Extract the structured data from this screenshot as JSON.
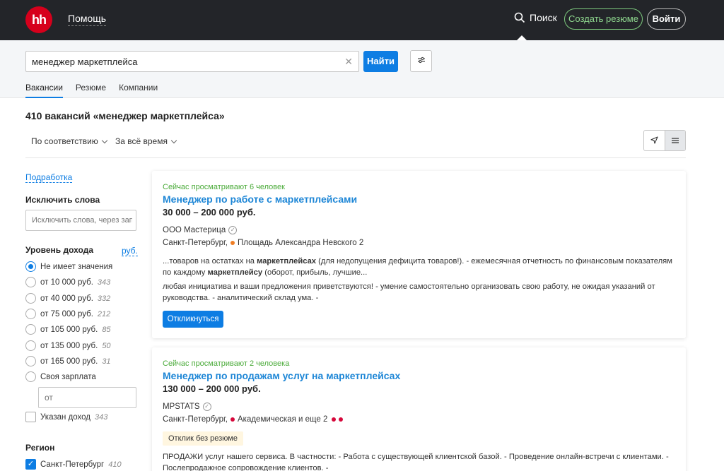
{
  "header": {
    "logo_text": "hh",
    "help": "Помощь",
    "search": "Поиск",
    "create_resume": "Создать резюме",
    "login": "Войти"
  },
  "search": {
    "query": "менеджер маркетплейса",
    "find_button": "Найти",
    "tabs": [
      "Вакансии",
      "Резюме",
      "Компании"
    ]
  },
  "results": {
    "title": "410 вакансий «менеджер маркетплейса»",
    "sort_relevance": "По соответствию",
    "sort_period": "За всё время"
  },
  "sidebar": {
    "podrabotka": "Подработка",
    "exclude_title": "Исключить слова",
    "exclude_placeholder": "Исключить слова, через запятую",
    "income_title": "Уровень дохода",
    "income_currency": "руб.",
    "income_options": [
      {
        "label": "Не имеет значения",
        "count": ""
      },
      {
        "label": "от 10 000 руб.",
        "count": "343"
      },
      {
        "label": "от 40 000 руб.",
        "count": "332"
      },
      {
        "label": "от 75 000 руб.",
        "count": "212"
      },
      {
        "label": "от 105 000 руб.",
        "count": "85"
      },
      {
        "label": "от 135 000 руб.",
        "count": "50"
      },
      {
        "label": "от 165 000 руб.",
        "count": "31"
      },
      {
        "label": "Своя зарплата",
        "count": ""
      }
    ],
    "own_salary_placeholder": "от",
    "income_specified": "Указан доход",
    "income_specified_count": "343",
    "region_title": "Регион",
    "region_spb": "Санкт-Петербург",
    "region_spb_count": "410"
  },
  "vacancies": [
    {
      "viewing": "Сейчас просматривают 6 человек",
      "title": "Менеджер по работе с маркетплейсами",
      "salary": "30 000 – 200 000 руб.",
      "company": "ООО Мастерица",
      "city": "Санкт-Петербург,",
      "metro": "Площадь Александра Невского 2",
      "metro_color": "#f07e24",
      "snippet_pre": "...товаров на остатках на ",
      "snippet_b1": "маркетплейсах",
      "snippet_mid": " (для недопущения дефицита товаров!). - ежемесячная отчетность по финансовым показателям по каждому ",
      "snippet_b2": "маркетплейсу",
      "snippet_post": " (оборот, прибыль, лучшие...",
      "requirements": "любая инициатива и ваши предложения приветствуются! - умение самостоятельно организовать свою работу, не ожидая указаний от руководства. - аналитический склад ума. -",
      "respond": "Откликнуться"
    },
    {
      "viewing": "Сейчас просматривают 2 человека",
      "title": "Менеджер по продажам услуг на маркетплейсах",
      "salary": "130 000 – 200 000 руб.",
      "company": "MPSTATS",
      "city": "Санкт-Петербург,",
      "metro": "Академическая и еще 2",
      "metro_color": "#d6083b",
      "badge": "Отклик без резюме",
      "snippet": "ПРОДАЖИ услуг нашего сервиса. В частности: - Работа с существующей клиентской базой. - Проведение онлайн-встречи с клиентами. - Послепродажное сопровождение клиентов. -"
    }
  ]
}
